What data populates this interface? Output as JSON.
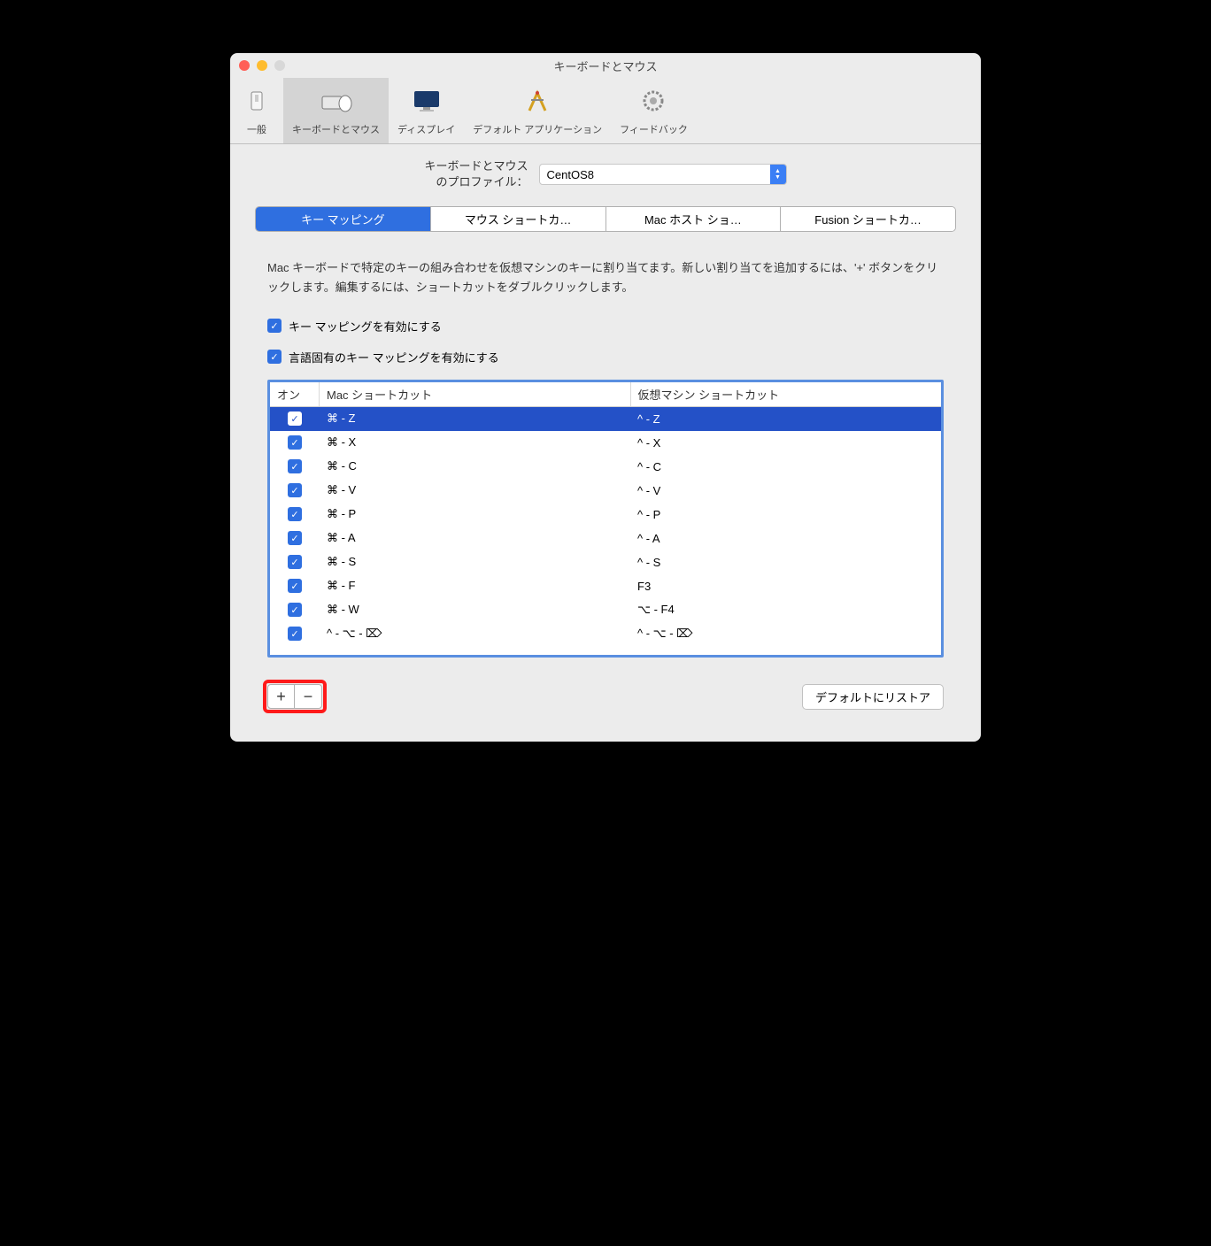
{
  "window_title": "キーボードとマウス",
  "toolbar": {
    "items": [
      {
        "label": "一般"
      },
      {
        "label": "キーボードとマウス"
      },
      {
        "label": "ディスプレイ"
      },
      {
        "label": "デフォルト アプリケーション"
      },
      {
        "label": "フィードバック"
      }
    ]
  },
  "profile": {
    "label_line1": "キーボードとマウス",
    "label_line2": "のプロファイル：",
    "value": "CentOS8"
  },
  "tabs": [
    "キー マッピング",
    "マウス ショートカ…",
    "Mac ホスト ショ…",
    "Fusion ショートカ…"
  ],
  "description": "Mac キーボードで特定のキーの組み合わせを仮想マシンのキーに割り当てます。新しい割り当てを追加するには、'+' ボタンをクリックします。編集するには、ショートカットをダブルクリックします。",
  "checks": {
    "enable_mapping": "キー マッピングを有効にする",
    "enable_lang": "言語固有のキー マッピングを有効にする"
  },
  "table": {
    "headers": {
      "on": "オン",
      "mac": "Mac ショートカット",
      "vm": "仮想マシン ショートカット"
    },
    "rows": [
      {
        "on": true,
        "mac": "⌘ - Z",
        "vm": "^ - Z",
        "selected": true
      },
      {
        "on": true,
        "mac": "⌘ - X",
        "vm": "^ - X"
      },
      {
        "on": true,
        "mac": "⌘ - C",
        "vm": "^ - C"
      },
      {
        "on": true,
        "mac": "⌘ - V",
        "vm": "^ - V"
      },
      {
        "on": true,
        "mac": "⌘ - P",
        "vm": "^ - P"
      },
      {
        "on": true,
        "mac": "⌘ - A",
        "vm": "^ - A"
      },
      {
        "on": true,
        "mac": "⌘ - S",
        "vm": "^ - S"
      },
      {
        "on": true,
        "mac": "⌘ - F",
        "vm": "F3"
      },
      {
        "on": true,
        "mac": "⌘ - W",
        "vm": "⌥ - F4"
      },
      {
        "on": true,
        "mac": "^ - ⌥ - ⌦",
        "vm": "^ - ⌥ - ⌦"
      }
    ]
  },
  "buttons": {
    "add": "+",
    "remove": "−",
    "restore": "デフォルトにリストア"
  }
}
